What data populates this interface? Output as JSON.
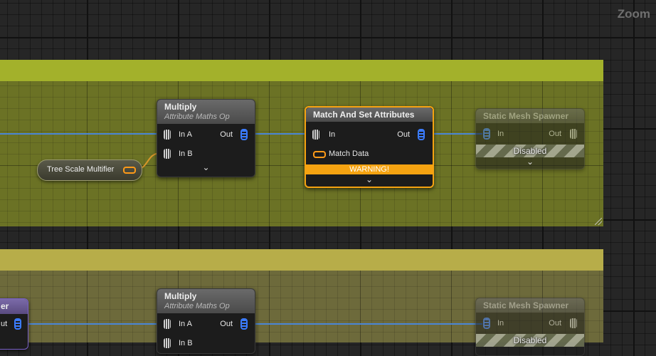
{
  "view": {
    "zoom_label": "Zoom"
  },
  "pill": {
    "label": "Tree Scale Multifier"
  },
  "nodes": {
    "multiply1": {
      "title": "Multiply",
      "subtitle": "Attribute Maths Op",
      "in_a": "In A",
      "in_b": "In B",
      "out": "Out",
      "expand": "⌄"
    },
    "match": {
      "title": "Match And Set Attributes",
      "in": "In",
      "out": "Out",
      "match_data": "Match Data",
      "warning": "WARNING!",
      "expand": "⌄"
    },
    "spawner1": {
      "title": "Static Mesh Spawner",
      "in": "In",
      "out": "Out",
      "status": "Disabled",
      "expand": "⌄"
    },
    "left_partial": {
      "title": "er",
      "out": "ut"
    },
    "multiply2": {
      "title": "Multiply",
      "subtitle": "Attribute Maths Op",
      "in_a": "In A",
      "in_b": "In B",
      "out": "Out"
    },
    "spawner2": {
      "title": "Static Mesh Spawner",
      "in": "In",
      "out": "Out",
      "status": "Disabled"
    }
  },
  "colors": {
    "comment1": "#a3b12b",
    "comment2": "#b7ad49",
    "warning": "#f5a311",
    "wire": "#4a86d6",
    "accent": "#ff9a18"
  }
}
